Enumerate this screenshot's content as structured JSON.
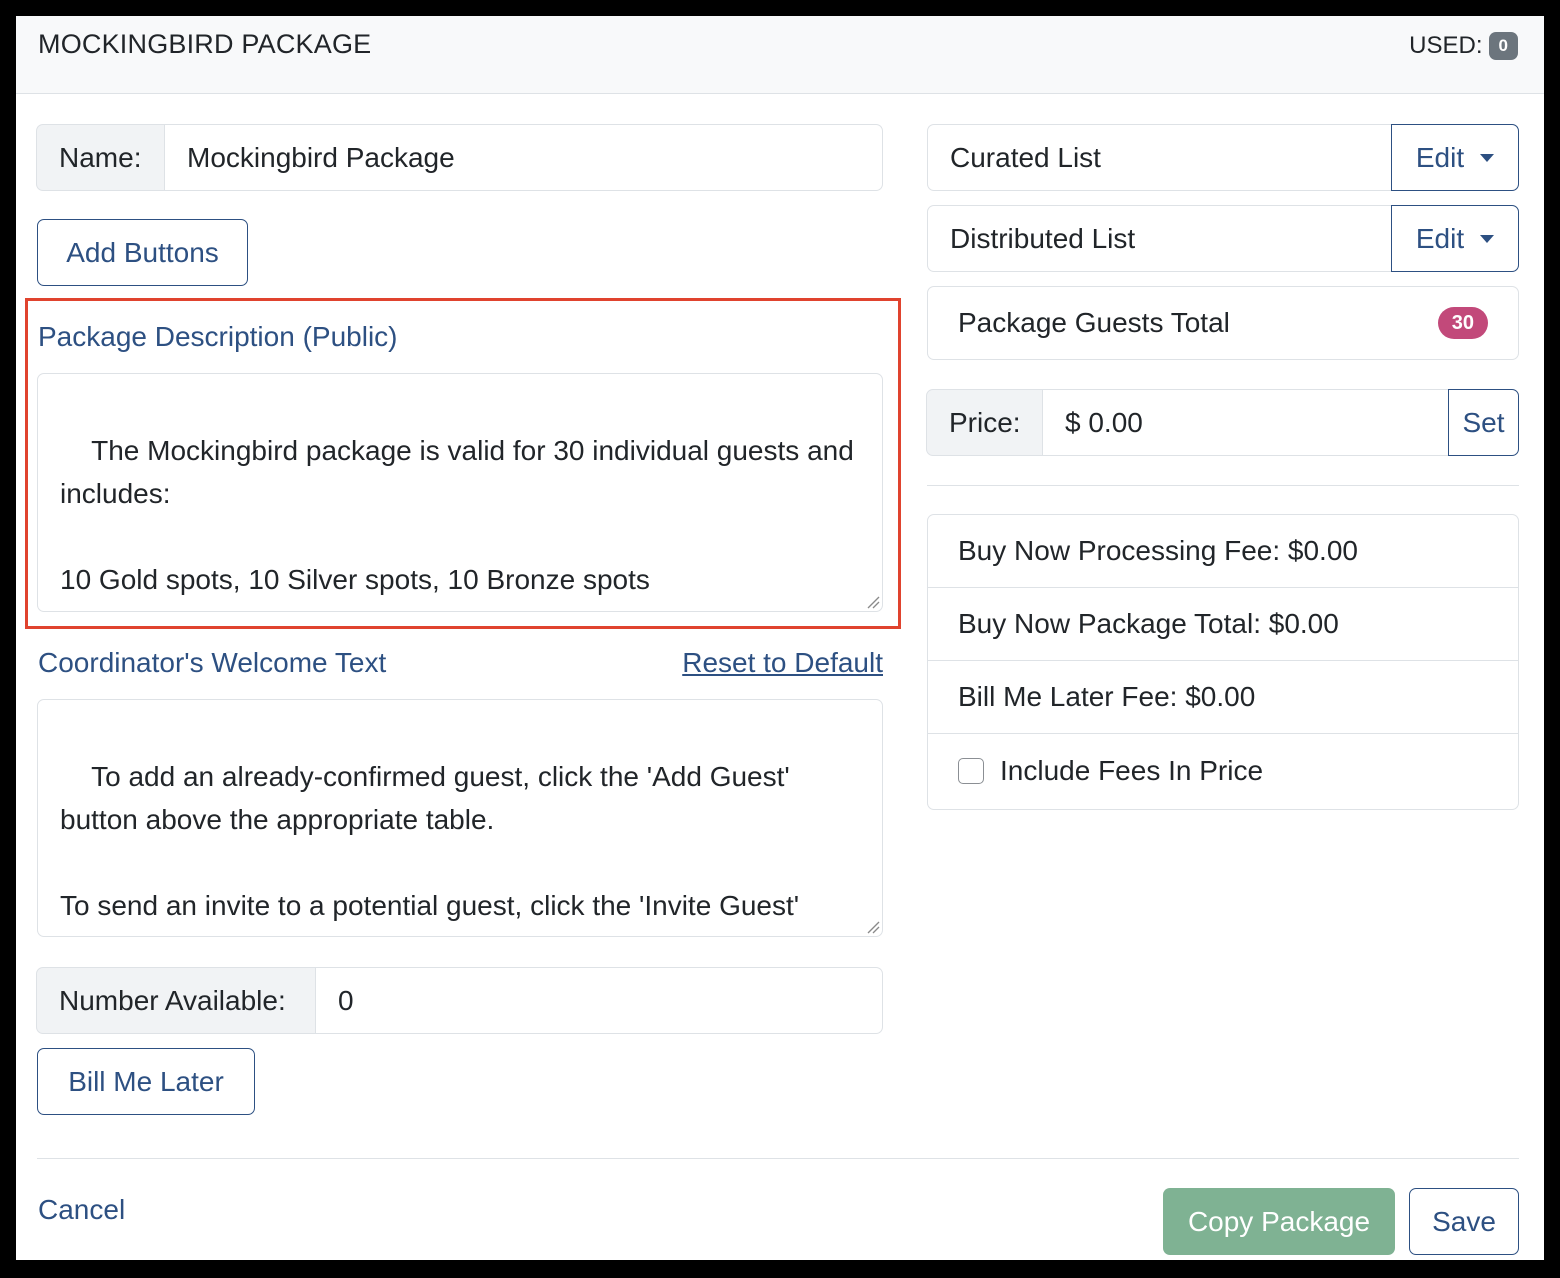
{
  "header": {
    "title": "MOCKINGBIRD PACKAGE",
    "used_label": "USED:",
    "used_count": "0"
  },
  "name_field": {
    "label": "Name:",
    "value": "Mockingbird Package"
  },
  "add_buttons_label": "Add Buttons",
  "package_description": {
    "label": "Package Description (Public)",
    "text": "The Mockingbird package is valid for 30 individual guests and includes:\n\n10 Gold spots, 10 Silver spots, 10 Bronze spots"
  },
  "welcome_text": {
    "label": "Coordinator's Welcome Text",
    "reset_label": "Reset to Default",
    "text": "To add an already-confirmed guest, click the 'Add Guest' button above the appropriate table.\n\nTo send an invite to a potential guest, click the 'Invite Guest' button above the appropriate table. The guest will receive an invitation email to confirm their spot at the table."
  },
  "number_available": {
    "label": "Number Available:",
    "value": "0"
  },
  "bill_me_later_label": "Bill Me Later",
  "curated_list": {
    "label": "Curated List",
    "edit_label": "Edit"
  },
  "distributed_list": {
    "label": "Distributed List",
    "edit_label": "Edit"
  },
  "package_guests": {
    "label": "Package Guests Total",
    "count": "30"
  },
  "price": {
    "label": "Price:",
    "value": "$ 0.00",
    "set_label": "Set"
  },
  "fees": {
    "processing": "Buy Now Processing Fee: $0.00",
    "package_total": "Buy Now Package Total: $0.00",
    "bill_later": "Bill Me Later Fee: $0.00",
    "include_label": "Include Fees In Price",
    "include_checked": false
  },
  "footer": {
    "cancel_label": "Cancel",
    "copy_label": "Copy Package",
    "save_label": "Save"
  },
  "colors": {
    "primary": "#2d5082",
    "highlight": "#e0432e",
    "badge_pink": "#c2497a",
    "copy_button": "#7fb293",
    "used_badge": "#6c757d"
  }
}
